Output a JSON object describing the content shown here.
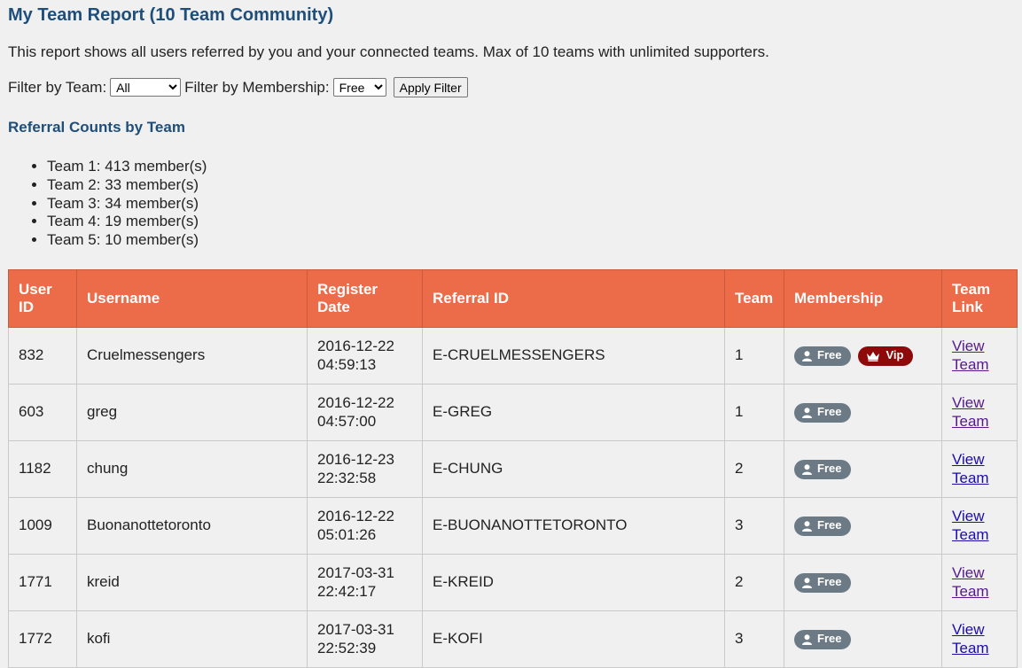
{
  "page": {
    "title": "My Team Report (10 Team Community)",
    "description": "This report shows all users referred by you and your connected teams. Max of 10 teams with unlimited supporters."
  },
  "filters": {
    "team_label": "Filter by Team:",
    "team_value": "All",
    "membership_label": "Filter by Membership:",
    "membership_value": "Free",
    "apply_label": "Apply Filter"
  },
  "counts": {
    "heading": "Referral Counts by Team",
    "items": [
      "Team 1: 413 member(s)",
      "Team 2: 33 member(s)",
      "Team 3: 34 member(s)",
      "Team 4: 19 member(s)",
      "Team 5: 10 member(s)"
    ]
  },
  "table": {
    "headers": [
      "User ID",
      "Username",
      "Register Date",
      "Referral ID",
      "Team",
      "Membership",
      "Team Link"
    ],
    "badge_free": "Free",
    "badge_vip": "Vip",
    "link_label": "View Team",
    "rows": [
      {
        "id": "832",
        "username": "Cruelmessengers",
        "date": "2016-12-22",
        "time": "04:59:13",
        "referral": "E-CRUELMESSENGERS",
        "team": "1",
        "vip": true
      },
      {
        "id": "603",
        "username": "greg",
        "date": "2016-12-22",
        "time": "04:57:00",
        "referral": "E-GREG",
        "team": "1",
        "vip": false
      },
      {
        "id": "1182",
        "username": "chung",
        "date": "2016-12-23",
        "time": "22:32:58",
        "referral": "E-CHUNG",
        "team": "2",
        "vip": false
      },
      {
        "id": "1009",
        "username": "Buonanottetoronto",
        "date": "2016-12-22",
        "time": "05:01:26",
        "referral": "E-BUONANOTTETORONTO",
        "team": "3",
        "vip": false
      },
      {
        "id": "1771",
        "username": "kreid",
        "date": "2017-03-31",
        "time": "22:42:17",
        "referral": "E-KREID",
        "team": "2",
        "vip": false
      },
      {
        "id": "1772",
        "username": "kofi",
        "date": "2017-03-31",
        "time": "22:52:39",
        "referral": "E-KOFI",
        "team": "3",
        "vip": false
      }
    ]
  },
  "colors": {
    "heading": "#1f4e79",
    "table_header": "#ec6b48",
    "badge_free": "#6c7a86",
    "badge_vip": "#8e0a0a"
  }
}
